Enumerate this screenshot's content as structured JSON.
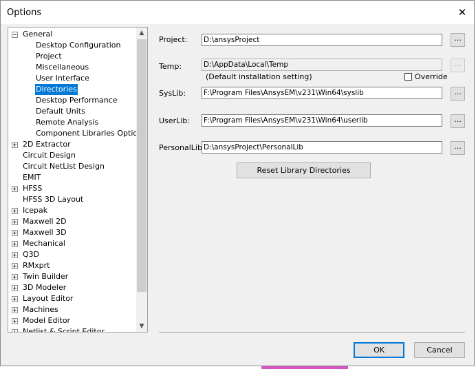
{
  "window": {
    "title": "Options"
  },
  "tree": {
    "items": [
      {
        "label": "General",
        "indent": 0,
        "expander": "minus",
        "selected": false
      },
      {
        "label": "Desktop Configuration",
        "indent": 1,
        "expander": "none",
        "selected": false
      },
      {
        "label": "Project",
        "indent": 1,
        "expander": "none",
        "selected": false
      },
      {
        "label": "Miscellaneous",
        "indent": 1,
        "expander": "none",
        "selected": false
      },
      {
        "label": "User Interface",
        "indent": 1,
        "expander": "none",
        "selected": false
      },
      {
        "label": "Directories",
        "indent": 1,
        "expander": "none",
        "selected": true
      },
      {
        "label": "Desktop Performance",
        "indent": 1,
        "expander": "none",
        "selected": false
      },
      {
        "label": "Default Units",
        "indent": 1,
        "expander": "none",
        "selected": false
      },
      {
        "label": "Remote Analysis",
        "indent": 1,
        "expander": "none",
        "selected": false
      },
      {
        "label": "Component Libraries Options",
        "indent": 1,
        "expander": "none",
        "selected": false
      },
      {
        "label": "2D Extractor",
        "indent": 0,
        "expander": "plus",
        "selected": false
      },
      {
        "label": "Circuit Design",
        "indent": 0,
        "expander": "none",
        "selected": false
      },
      {
        "label": "Circuit NetList Design",
        "indent": 0,
        "expander": "none",
        "selected": false
      },
      {
        "label": "EMIT",
        "indent": 0,
        "expander": "none",
        "selected": false
      },
      {
        "label": "HFSS",
        "indent": 0,
        "expander": "plus",
        "selected": false
      },
      {
        "label": "HFSS 3D Layout",
        "indent": 0,
        "expander": "none",
        "selected": false
      },
      {
        "label": "Icepak",
        "indent": 0,
        "expander": "plus",
        "selected": false
      },
      {
        "label": "Maxwell 2D",
        "indent": 0,
        "expander": "plus",
        "selected": false
      },
      {
        "label": "Maxwell 3D",
        "indent": 0,
        "expander": "plus",
        "selected": false
      },
      {
        "label": "Mechanical",
        "indent": 0,
        "expander": "plus",
        "selected": false
      },
      {
        "label": "Q3D",
        "indent": 0,
        "expander": "plus",
        "selected": false
      },
      {
        "label": "RMxprt",
        "indent": 0,
        "expander": "plus",
        "selected": false
      },
      {
        "label": "Twin Builder",
        "indent": 0,
        "expander": "plus",
        "selected": false
      },
      {
        "label": "3D Modeler",
        "indent": 0,
        "expander": "plus",
        "selected": false
      },
      {
        "label": "Layout Editor",
        "indent": 0,
        "expander": "plus",
        "selected": false
      },
      {
        "label": "Machines",
        "indent": 0,
        "expander": "plus",
        "selected": false
      },
      {
        "label": "Model Editor",
        "indent": 0,
        "expander": "plus",
        "selected": false
      },
      {
        "label": "Netlist & Script Editor",
        "indent": 0,
        "expander": "plus",
        "selected": false
      }
    ],
    "scroll_up": "▲",
    "scroll_down": "▼"
  },
  "fields": {
    "project": {
      "label": "Project:",
      "value": "D:\\ansysProject",
      "enabled": true
    },
    "temp": {
      "label": "Temp:",
      "value": "D:\\AppData\\Local\\Temp",
      "enabled": false
    },
    "syslib": {
      "label": "SysLib:",
      "value": "F:\\Program Files\\AnsysEM\\v231\\Win64\\syslib",
      "enabled": true
    },
    "userlib": {
      "label": "UserLib:",
      "value": "F:\\Program Files\\AnsysEM\\v231\\Win64\\userlib",
      "enabled": true
    },
    "personallib": {
      "label": "PersonalLib:",
      "value": "D:\\ansysProject\\PersonalLib",
      "enabled": true
    }
  },
  "temp_note": "(Default installation setting)",
  "override": {
    "label": "Override",
    "checked": false
  },
  "browse_label": "...",
  "reset_button": "Reset Library Directories",
  "buttons": {
    "ok": "OK",
    "cancel": "Cancel"
  },
  "close_glyph": "✕"
}
